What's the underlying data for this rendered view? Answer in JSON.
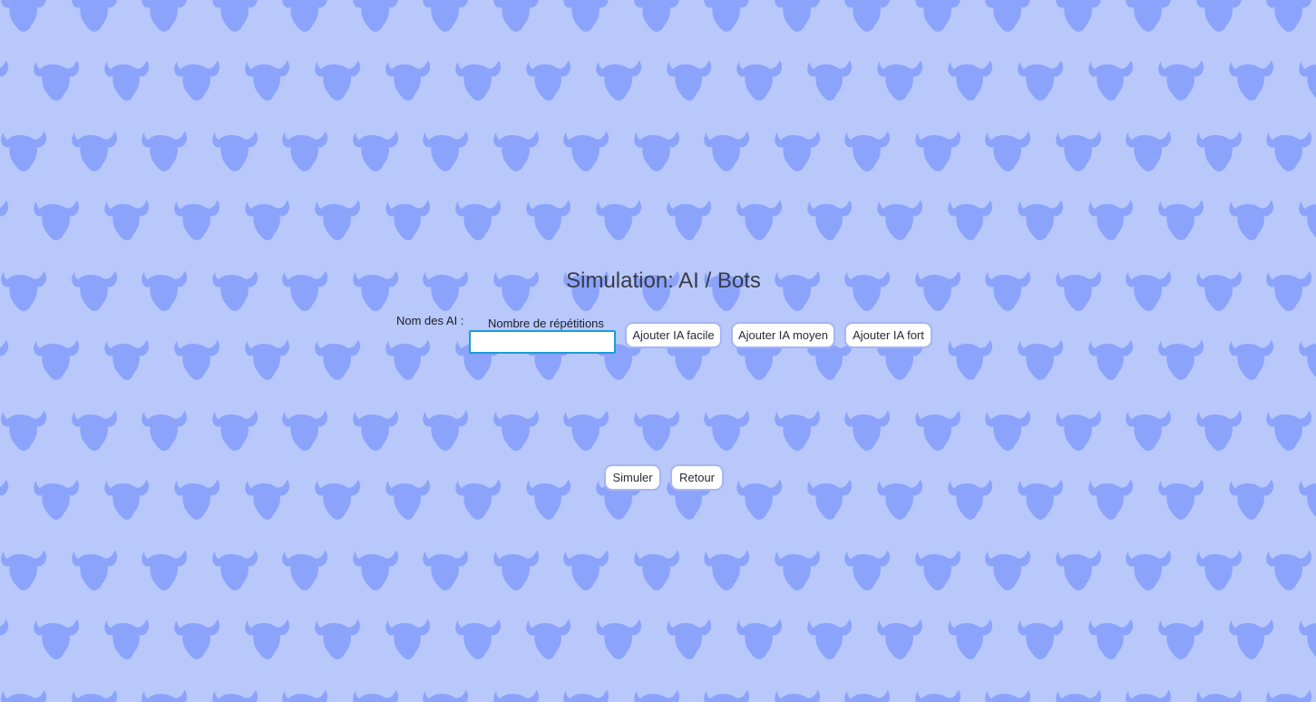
{
  "page": {
    "title": "Simulation: AI / Bots",
    "background_color": "#b8c8fb",
    "pattern_color": "#8ba3fb",
    "pattern_icon": "bull-head-icon"
  },
  "form": {
    "ai_names_label": "Nom des AI :",
    "repetitions_label": "Nombre de répétitions",
    "repetitions_value": "",
    "repetitions_border_color": "#1a9ed8"
  },
  "buttons": {
    "add_easy": "Ajouter IA facile",
    "add_medium": "Ajouter IA moyen",
    "add_hard": "Ajouter IA fort",
    "simulate": "Simuler",
    "back": "Retour"
  }
}
